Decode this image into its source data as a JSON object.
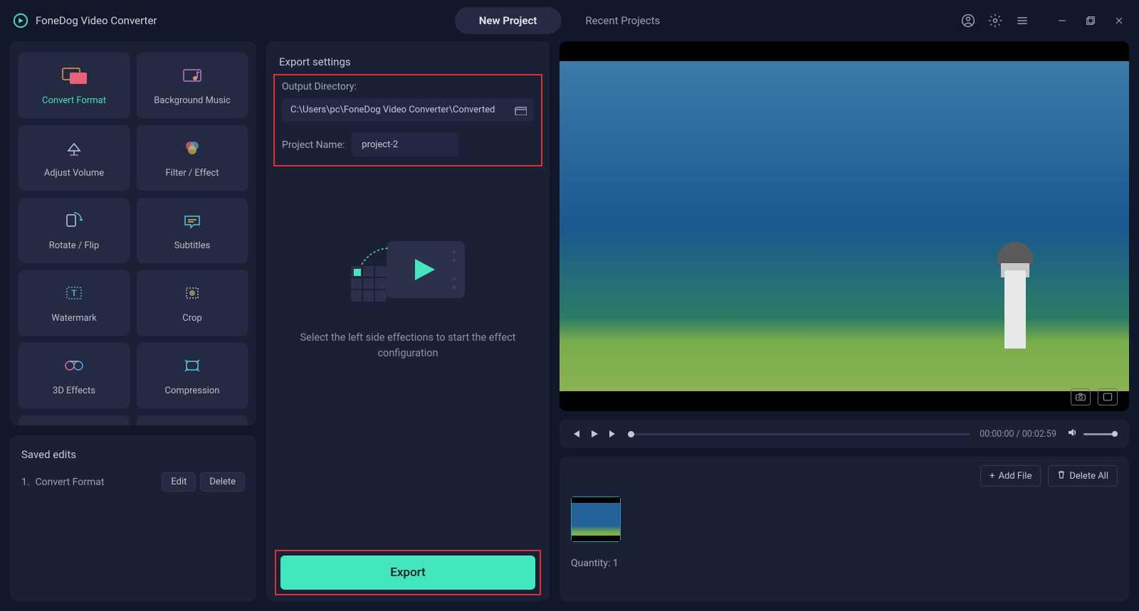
{
  "app": {
    "title": "FoneDog Video Converter"
  },
  "tabs": {
    "new_project": "New Project",
    "recent_projects": "Recent Projects"
  },
  "tools": [
    {
      "label": "Convert Format"
    },
    {
      "label": "Background Music"
    },
    {
      "label": "Adjust Volume"
    },
    {
      "label": "Filter / Effect"
    },
    {
      "label": "Rotate / Flip"
    },
    {
      "label": "Subtitles"
    },
    {
      "label": "Watermark"
    },
    {
      "label": "Crop"
    },
    {
      "label": "3D Effects"
    },
    {
      "label": "Compression"
    }
  ],
  "saved": {
    "title": "Saved edits",
    "entries": [
      {
        "idx": "1.",
        "name": "Convert Format"
      }
    ],
    "edit": "Edit",
    "delete": "Delete"
  },
  "export": {
    "title": "Export settings",
    "output_directory_label": "Output Directory:",
    "output_directory_value": "C:\\Users\\pc\\FoneDog Video Converter\\Converted",
    "project_name_label": "Project Name:",
    "project_name_value": "project-2",
    "placeholder_text": "Select the left side effections to start the effect configuration",
    "export_button": "Export"
  },
  "player": {
    "time_current": "00:00:00",
    "time_total": "00:02:59"
  },
  "files": {
    "add_file": "Add File",
    "delete_all": "Delete All",
    "quantity_label": "Quantity:",
    "quantity_value": "1"
  }
}
